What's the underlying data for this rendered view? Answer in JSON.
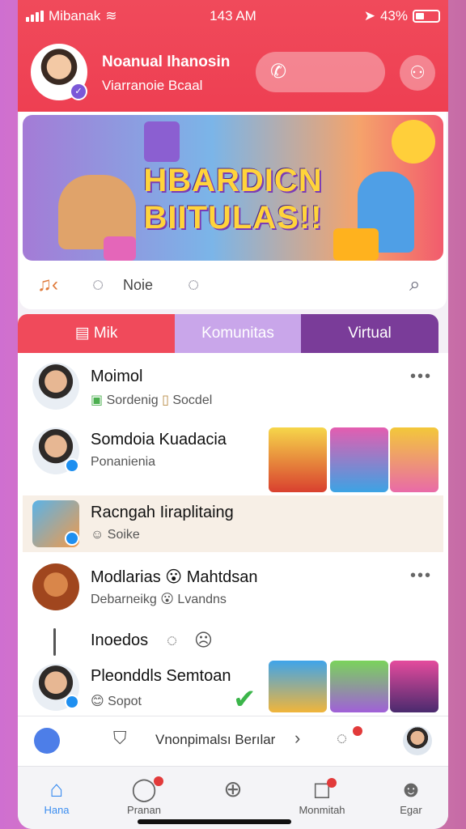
{
  "status": {
    "carrier": "Mibanak",
    "time": "143 AM",
    "battery": "43%"
  },
  "header": {
    "user_name": "Noanual Ihanosin",
    "user_sub": "Viarranoie Bcaal"
  },
  "banner": {
    "title_line1": "HBARDICN",
    "title_line2": "BIITULAS!!"
  },
  "toolbar": {
    "label": "Noie"
  },
  "tabs": [
    {
      "label": "Mik"
    },
    {
      "label": "Komunitas"
    },
    {
      "label": "Virtual"
    }
  ],
  "rows": [
    {
      "name": "Moimol",
      "sub": "Sordenig",
      "sub2": "Socdel"
    },
    {
      "name": "Somdoia Kuadacia",
      "sub": "Ponanienia"
    },
    {
      "name": "Racngah Iiraplitaing",
      "sub": "Soike"
    },
    {
      "name": "Modlarias",
      "name2": "Mahtdsan",
      "sub": "Debarneikg",
      "sub2": "Lvandns"
    },
    {
      "name": "Inoedos"
    },
    {
      "name": "Pleonddls Semtoan",
      "sub": "Sopot"
    }
  ],
  "composer": {
    "text": "Vnonpimalsı Berılar"
  },
  "nav": [
    {
      "label": "Hana",
      "icon": "home-icon"
    },
    {
      "label": "Pranan",
      "icon": "chat-icon"
    },
    {
      "label": "",
      "icon": "plus-icon"
    },
    {
      "label": "Monmitah",
      "icon": "message-icon"
    },
    {
      "label": "Egar",
      "icon": "person-icon"
    }
  ],
  "colors": {
    "accent": "#f04a5b",
    "tab_mid": "#c9a6ea",
    "tab_dark": "#7a3c99",
    "nav_active": "#3b8df0"
  }
}
